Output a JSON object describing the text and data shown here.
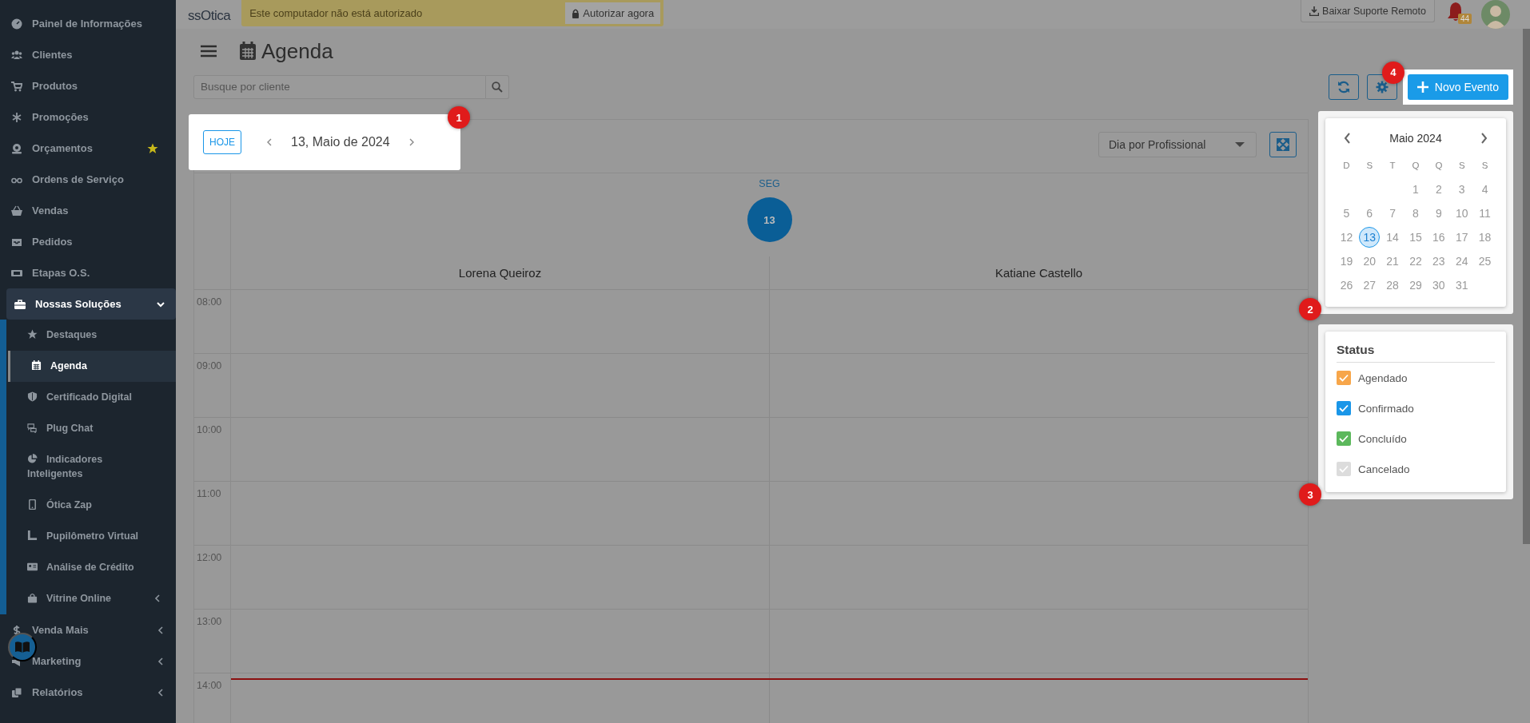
{
  "sidebar": {
    "items": [
      {
        "label": "Painel de Informações",
        "selected": false
      },
      {
        "label": "Clientes",
        "selected": false
      },
      {
        "label": "Produtos",
        "selected": false
      },
      {
        "label": "Promoções",
        "selected": false
      },
      {
        "label": "Orçamentos",
        "selected": false,
        "starred": true
      },
      {
        "label": "Ordens de Serviço",
        "selected": false
      },
      {
        "label": "Vendas",
        "selected": false
      },
      {
        "label": "Pedidos",
        "selected": false
      },
      {
        "label": "Etapas O.S.",
        "selected": false
      },
      {
        "label": "Nossas Soluções",
        "selected": false,
        "expanded": true,
        "children": [
          {
            "label": "Destaques",
            "selected": false
          },
          {
            "label": "Agenda",
            "selected": true
          },
          {
            "label": "Certificado Digital",
            "selected": false
          },
          {
            "label": "Plug Chat",
            "selected": false
          },
          {
            "label": "Indicadores Inteligentes",
            "selected": false
          },
          {
            "label": "Ótica Zap",
            "selected": false
          },
          {
            "label": "Pupilômetro Virtual",
            "selected": false
          },
          {
            "label": "Análise de Crédito",
            "selected": false
          },
          {
            "label": "Vitrine Online",
            "selected": false,
            "expanded": false
          }
        ]
      },
      {
        "label": "Venda Mais",
        "selected": false,
        "expanded": false
      },
      {
        "label": "Marketing",
        "selected": false,
        "expanded": false
      },
      {
        "label": "Relatórios",
        "selected": false,
        "expanded": false
      }
    ]
  },
  "topbar": {
    "logo": "ssOtica",
    "alert": {
      "text": "Este computador não está autorizado",
      "button": "Autorizar agora"
    },
    "support_button": "Baixar Suporte Remoto",
    "notifications": {
      "count": "44"
    }
  },
  "page": {
    "title": "Agenda",
    "search": {
      "placeholder": "Busque por cliente"
    },
    "new_event": {
      "label": "Novo Evento",
      "step": "4"
    }
  },
  "calendar": {
    "date_nav": {
      "today_button": "HOJE",
      "date": "13, Maio de 2024",
      "step": "1"
    },
    "view": "Dia por Profissional",
    "weekday": "SEG",
    "day": "13",
    "professionals": [
      "Lorena Queiroz",
      "Katiane Castello"
    ],
    "hours": [
      "08:00",
      "09:00",
      "10:00",
      "11:00",
      "12:00",
      "13:00",
      "14:00"
    ]
  },
  "mini_calendar": {
    "month": "Maio 2024",
    "step": "2",
    "weekdays": [
      "D",
      "S",
      "T",
      "Q",
      "Q",
      "S",
      "S"
    ],
    "weeks": [
      [
        {
          "label": "1",
          "selected": false
        },
        {
          "label": "2",
          "selected": false
        },
        {
          "label": "3",
          "selected": false
        },
        {
          "label": "4",
          "selected": false
        }
      ],
      [
        {
          "label": "5",
          "selected": false
        },
        {
          "label": "6",
          "selected": false
        },
        {
          "label": "7",
          "selected": false
        },
        {
          "label": "8",
          "selected": false
        },
        {
          "label": "9",
          "selected": false
        },
        {
          "label": "10",
          "selected": false
        },
        {
          "label": "11",
          "selected": false
        }
      ],
      [
        {
          "label": "12",
          "selected": false
        },
        {
          "label": "13",
          "selected": true
        },
        {
          "label": "14",
          "selected": false
        },
        {
          "label": "15",
          "selected": false
        },
        {
          "label": "16",
          "selected": false
        },
        {
          "label": "17",
          "selected": false
        },
        {
          "label": "18",
          "selected": false
        }
      ],
      [
        {
          "label": "19",
          "selected": false
        },
        {
          "label": "20",
          "selected": false
        },
        {
          "label": "21",
          "selected": false
        },
        {
          "label": "22",
          "selected": false
        },
        {
          "label": "23",
          "selected": false
        },
        {
          "label": "24",
          "selected": false
        },
        {
          "label": "25",
          "selected": false
        }
      ],
      [
        {
          "label": "26",
          "selected": false
        },
        {
          "label": "27",
          "selected": false
        },
        {
          "label": "28",
          "selected": false
        },
        {
          "label": "29",
          "selected": false
        },
        {
          "label": "30",
          "selected": false
        },
        {
          "label": "31",
          "selected": false
        }
      ]
    ]
  },
  "status": {
    "title": "Status",
    "step": "3",
    "items": [
      {
        "label": "Agendado",
        "checked": true,
        "color": "#f7a64a"
      },
      {
        "label": "Confirmado",
        "checked": true,
        "color": "#1a96e8"
      },
      {
        "label": "Concluído",
        "checked": true,
        "color": "#5cb85c"
      },
      {
        "label": "Cancelado",
        "checked": true,
        "color": "#dcdcdc"
      }
    ]
  }
}
